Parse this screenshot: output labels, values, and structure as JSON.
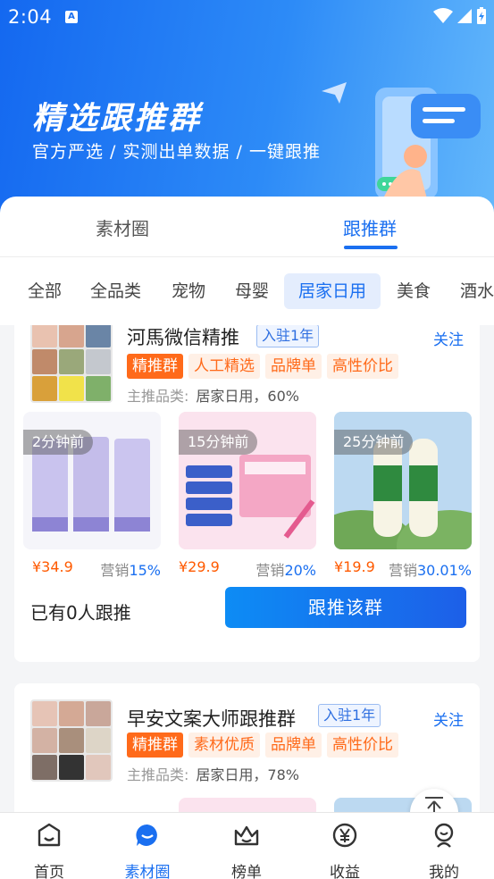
{
  "status_bar": {
    "time": "2:04",
    "app_icon": "A"
  },
  "hero": {
    "title": "精选跟推群",
    "subtitle": "官方严选 / 实测出单数据 / 一键跟推"
  },
  "main_tabs": [
    {
      "label": "素材圈"
    },
    {
      "label": "跟推群"
    }
  ],
  "categories": [
    {
      "label": "全部"
    },
    {
      "label": "全品类"
    },
    {
      "label": "宠物"
    },
    {
      "label": "母婴"
    },
    {
      "label": "居家日用"
    },
    {
      "label": "美食"
    },
    {
      "label": "酒水"
    }
  ],
  "cards": [
    {
      "name": "河馬微信精推",
      "since": "入驻1年",
      "follow": "关注",
      "tags": [
        "精推群",
        "人工精选",
        "品牌单",
        "高性价比"
      ],
      "main_cat_label": "主推品类:",
      "main_cat_value": "居家日用，60%",
      "products": [
        {
          "time": "2分钟前",
          "price": "¥34.9",
          "sales_label": "营销",
          "sales_value": "15%"
        },
        {
          "time": "15分钟前",
          "price": "¥29.9",
          "sales_label": "营销",
          "sales_value": "20%"
        },
        {
          "time": "25分钟前",
          "price": "¥19.9",
          "sales_label": "营销",
          "sales_value": "30.01%"
        }
      ],
      "joined": "已有0人跟推",
      "button": "跟推该群"
    },
    {
      "name": "早安文案大师跟推群",
      "since": "入驻1年",
      "follow": "关注",
      "tags": [
        "精推群",
        "素材优质",
        "品牌单",
        "高性价比"
      ],
      "main_cat_label": "主推品类:",
      "main_cat_value": "居家日用，78%"
    }
  ],
  "bottom_nav": [
    {
      "label": "首页"
    },
    {
      "label": "素材圈"
    },
    {
      "label": "榜单"
    },
    {
      "label": "收益"
    },
    {
      "label": "我的"
    }
  ],
  "colors": {
    "accent": "#1a6ff0",
    "orange": "#ff6a1a",
    "price": "#ff5a00"
  }
}
